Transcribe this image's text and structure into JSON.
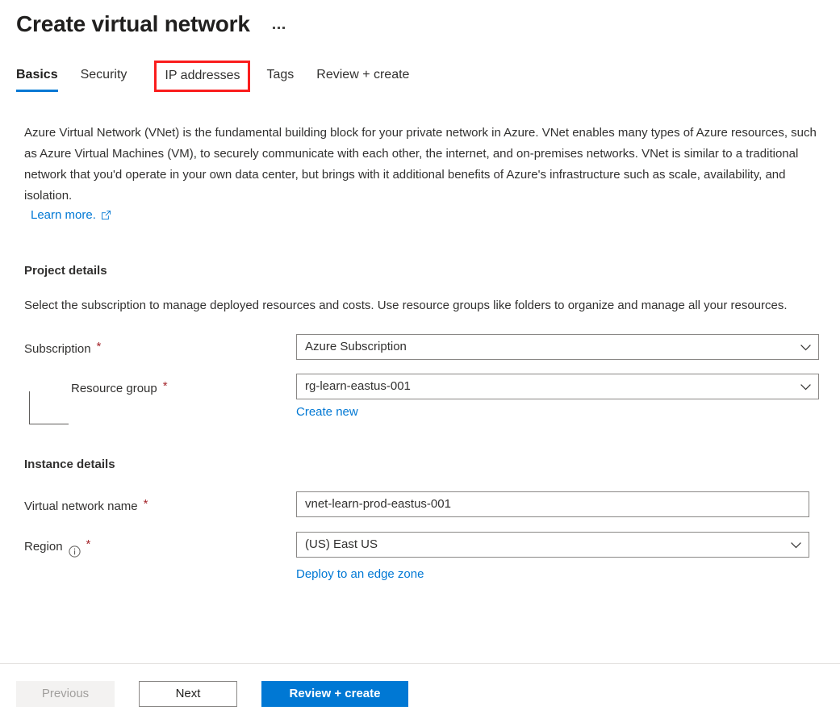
{
  "header": {
    "title": "Create virtual network",
    "more_actions_label": "More actions"
  },
  "tabs": [
    {
      "label": "Basics",
      "active": true
    },
    {
      "label": "Security",
      "active": false
    },
    {
      "label": "IP addresses",
      "active": false,
      "highlighted": true
    },
    {
      "label": "Tags",
      "active": false
    },
    {
      "label": "Review + create",
      "active": false
    }
  ],
  "intro": {
    "paragraph": "Azure Virtual Network (VNet) is the fundamental building block for your private network in Azure. VNet enables many types of Azure resources, such as Azure Virtual Machines (VM), to securely communicate with each other, the internet, and on-premises networks. VNet is similar to a traditional network that you'd operate in your own data center, but brings with it additional benefits of Azure's infrastructure such as scale, availability, and isolation.",
    "learn_more_label": "Learn more."
  },
  "project_details": {
    "title": "Project details",
    "description": "Select the subscription to manage deployed resources and costs. Use resource groups like folders to organize and manage all your resources.",
    "subscription": {
      "label": "Subscription",
      "value": "Azure Subscription",
      "required": "*"
    },
    "resource_group": {
      "label": "Resource group",
      "value": "rg-learn-eastus-001",
      "required": "*",
      "create_new_label": "Create new"
    }
  },
  "instance_details": {
    "title": "Instance details",
    "vnet_name": {
      "label": "Virtual network name",
      "value": "vnet-learn-prod-eastus-001",
      "required": "*"
    },
    "region": {
      "label": "Region",
      "value": "(US) East US",
      "required": "*",
      "edge_zone_label": "Deploy to an edge zone"
    }
  },
  "footer": {
    "previous_label": "Previous",
    "next_label": "Next",
    "review_create_label": "Review + create"
  },
  "colors": {
    "accent": "#0078d4",
    "required": "#a4262c",
    "highlight": "#fa1d1d",
    "border": "#8a8886"
  }
}
